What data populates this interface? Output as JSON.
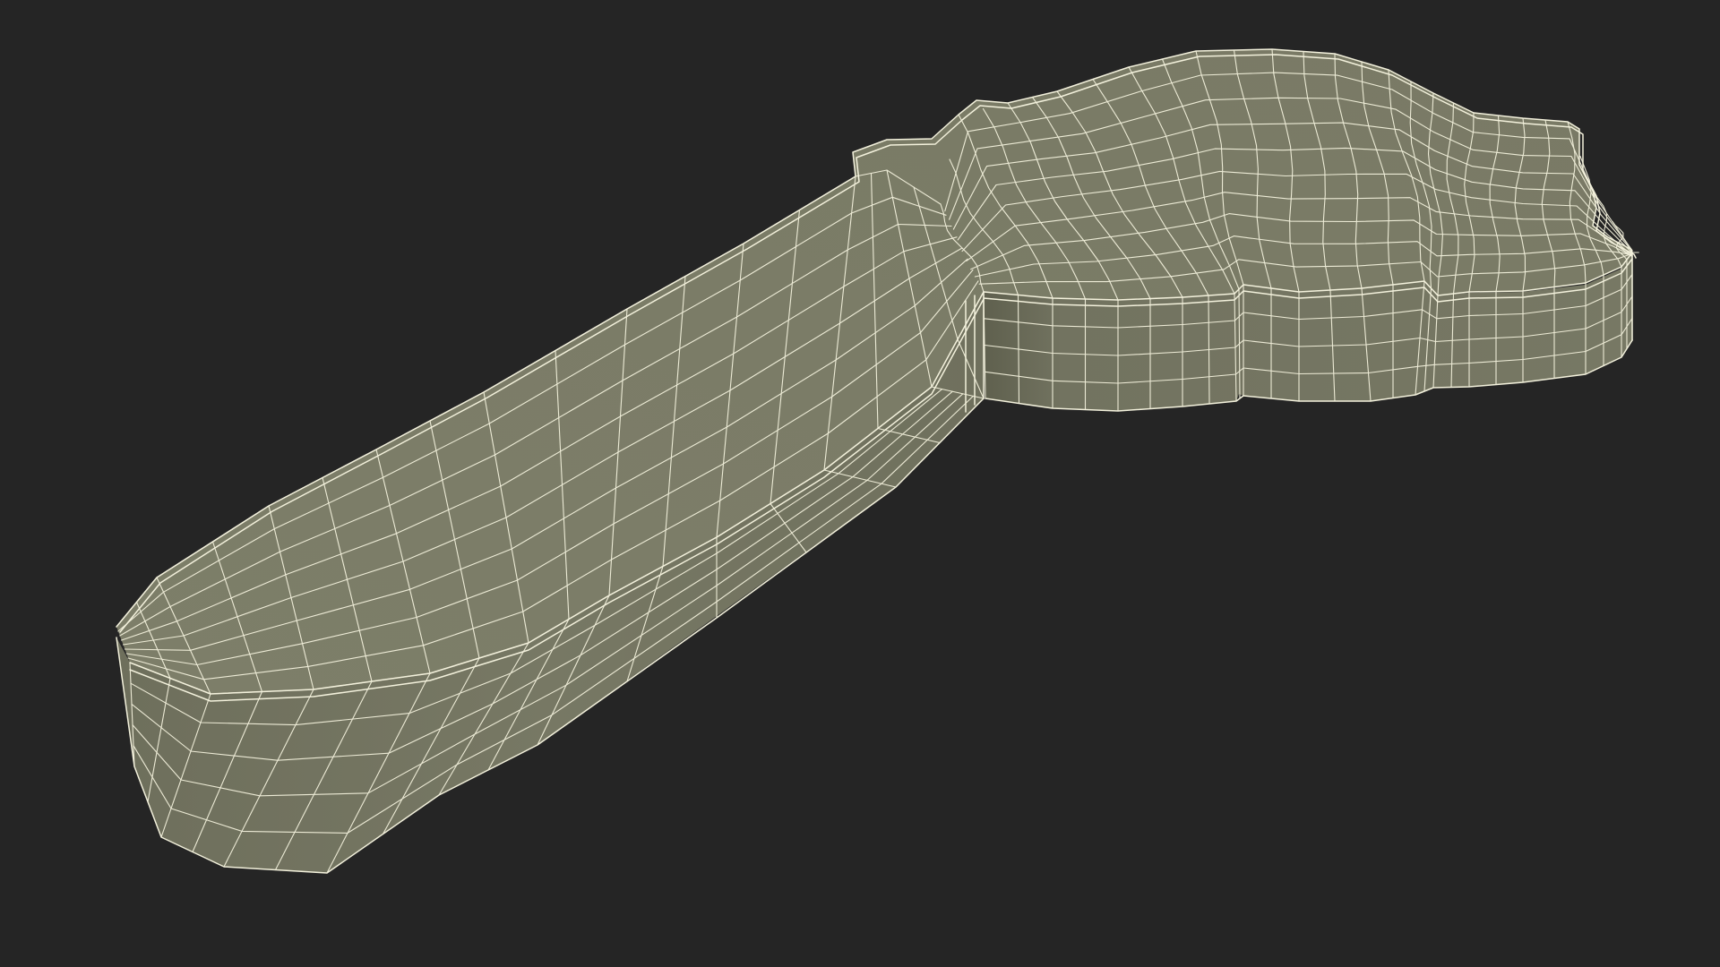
{
  "scene": {
    "subject": "wireframe-3d-model",
    "colors": {
      "background": "#252525",
      "surface_top": "#7b7c67",
      "surface_side": "#727360",
      "surface_shade": "#686955",
      "wire": "#f3f1dc"
    }
  }
}
